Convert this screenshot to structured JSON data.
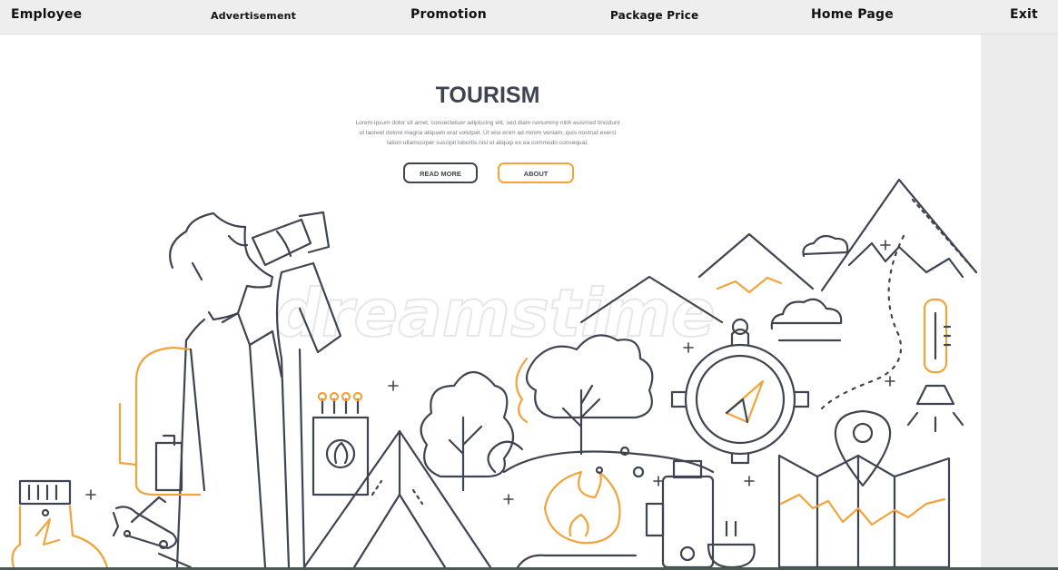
{
  "nav": {
    "items": [
      {
        "id": "employee",
        "label": "Employee"
      },
      {
        "id": "advertisement",
        "label": "Advertisement"
      },
      {
        "id": "promotion",
        "label": "Promotion"
      },
      {
        "id": "package-price",
        "label": "Package Price"
      },
      {
        "id": "home-page",
        "label": "Home Page"
      },
      {
        "id": "exit",
        "label": "Exit"
      }
    ]
  },
  "hero": {
    "title": "TOURISM",
    "description": [
      "Lorem ipsum dolor sit amet, consectetuer adipiscing elit, sed diam nonummy nibh euismod tincidunt",
      "ut laoreet dolore magna aliquam erat volutpat. Ut wisi enim ad minim veniam, quis nostrud exerci",
      "tation ullamcorper suscipit lobortis nisl ut aliquip ex ea commodo consequat."
    ],
    "read_more_label": "READ MORE",
    "about_label": "ABOUT",
    "watermark": "dreamstime"
  },
  "colors": {
    "line": "#3f4451",
    "accent": "#f2a33a",
    "nav_bg": "#eeeeee",
    "side_bg": "#ececec"
  },
  "icons": [
    "binoculars-icon",
    "backpack-icon",
    "tent-icon",
    "tree-icon",
    "compass-icon",
    "map-icon",
    "location-pin-icon",
    "thermometer-icon",
    "flashlight-icon",
    "campfire-icon",
    "thermos-icon",
    "matches-icon",
    "boot-icon",
    "pocket-knife-icon",
    "mountain-icon",
    "cloud-icon",
    "sparkle-icon"
  ]
}
